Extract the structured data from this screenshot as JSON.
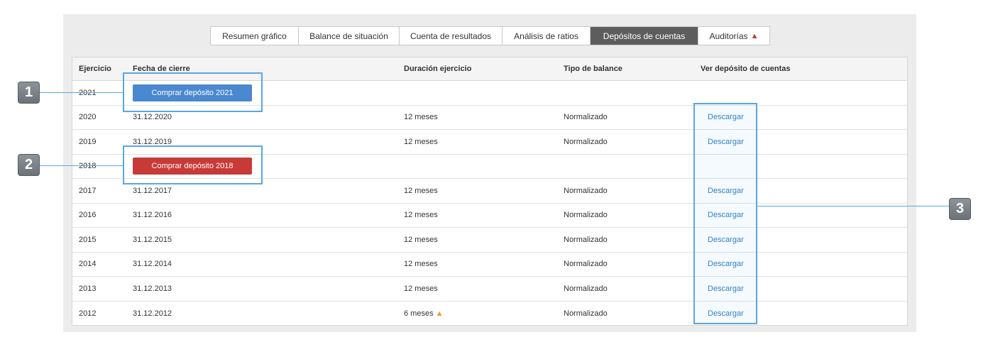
{
  "tabs": [
    {
      "label": "Resumen gráfico",
      "active": false,
      "warning": false
    },
    {
      "label": "Balance de situación",
      "active": false,
      "warning": false
    },
    {
      "label": "Cuenta de resultados",
      "active": false,
      "warning": false
    },
    {
      "label": "Análisis de ratios",
      "active": false,
      "warning": false
    },
    {
      "label": "Depósitos de cuentas",
      "active": true,
      "warning": false
    },
    {
      "label": "Auditorías",
      "active": false,
      "warning": true
    }
  ],
  "table": {
    "headers": {
      "year": "Ejercicio",
      "close_date": "Fecha de cierre",
      "duration": "Duración ejercicio",
      "balance_type": "Tipo de balance",
      "view_deposit": "Ver depósito de cuentas"
    },
    "rows": [
      {
        "year": "2021",
        "buy_button": "Comprar depósito 2021",
        "button_color": "blue"
      },
      {
        "year": "2020",
        "close_date": "31.12.2020",
        "duration": "12 meses",
        "balance_type": "Normalizado",
        "download": "Descargar"
      },
      {
        "year": "2019",
        "close_date": "31.12.2019",
        "duration": "12 meses",
        "balance_type": "Normalizado",
        "download": "Descargar"
      },
      {
        "year": "2018",
        "buy_button": "Comprar depósito 2018",
        "button_color": "red"
      },
      {
        "year": "2017",
        "close_date": "31.12.2017",
        "duration": "12 meses",
        "balance_type": "Normalizado",
        "download": "Descargar"
      },
      {
        "year": "2016",
        "close_date": "31.12.2016",
        "duration": "12 meses",
        "balance_type": "Normalizado",
        "download": "Descargar"
      },
      {
        "year": "2015",
        "close_date": "31.12.2015",
        "duration": "12 meses",
        "balance_type": "Normalizado",
        "download": "Descargar"
      },
      {
        "year": "2014",
        "close_date": "31.12.2014",
        "duration": "12 meses",
        "balance_type": "Normalizado",
        "download": "Descargar"
      },
      {
        "year": "2013",
        "close_date": "31.12.2013",
        "duration": "12 meses",
        "balance_type": "Normalizado",
        "download": "Descargar"
      },
      {
        "year": "2012",
        "close_date": "31.12.2012",
        "duration": "6 meses",
        "duration_warning": true,
        "balance_type": "Normalizado",
        "download": "Descargar"
      }
    ]
  },
  "annotations": [
    {
      "number": "1"
    },
    {
      "number": "2"
    },
    {
      "number": "3"
    }
  ],
  "colors": {
    "active_tab": "#5d5d5d",
    "buy_blue": "#4a88cf",
    "buy_red": "#c83a38",
    "link": "#2f80c6",
    "highlight": "#5ba6e6",
    "warning_red": "#c0392b",
    "warning_orange": "#e0a030"
  },
  "icons": {
    "tab_warning": "warning-triangle-icon",
    "duration_warning": "warning-triangle-icon"
  }
}
